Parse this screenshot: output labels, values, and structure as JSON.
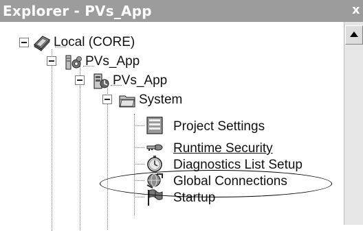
{
  "window": {
    "title": "Explorer - PVs_App",
    "close_glyph": "x"
  },
  "tree": {
    "nodes": [
      {
        "label": "Local (CORE)",
        "icon": "local-computer-icon"
      },
      {
        "label": "PVs_App",
        "icon": "application-icon"
      },
      {
        "label": "PVs_App",
        "icon": "project-server-icon"
      },
      {
        "label": "System",
        "icon": "folder-icon"
      },
      {
        "label": "Project Settings",
        "icon": "settings-document-icon"
      },
      {
        "label": "Runtime Security",
        "icon": "key-icon"
      },
      {
        "label": "Diagnostics List Setup",
        "icon": "stopwatch-icon"
      },
      {
        "label": "Global Connections",
        "icon": "globe-connections-icon"
      },
      {
        "label": "Startup",
        "icon": "flag-icon"
      }
    ],
    "highlighted": "Diagnostics List Setup"
  },
  "colors": {
    "titlebar": "#9c9c9c",
    "tree_lines": "#6e6e6e"
  }
}
